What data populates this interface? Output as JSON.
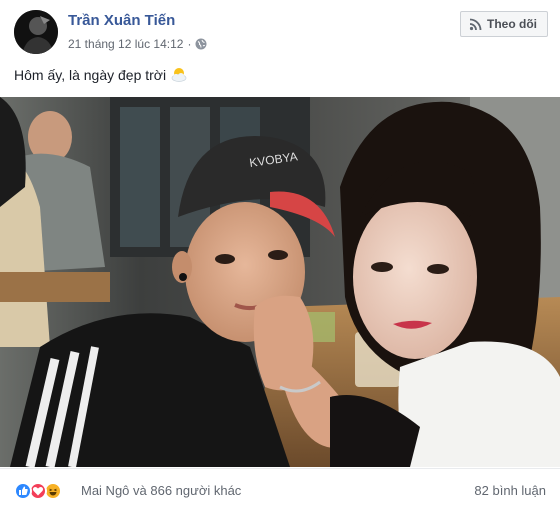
{
  "post": {
    "author": "Trần Xuân Tiến",
    "date": "21 tháng 12 lúc 14:12",
    "separator": "·",
    "follow_label": "Theo dõi",
    "caption": "Hôm ấy, là ngày đẹp trời",
    "caption_emoji": "sun-behind-cloud-icon",
    "photo_cap_text": "KVOBYA"
  },
  "footer": {
    "reactions": [
      "like",
      "love",
      "haha"
    ],
    "reactions_text": "Mai Ngô và 866 người khác",
    "comments_text": "82 bình luận"
  },
  "colors": {
    "author": "#385898",
    "meta": "#616770",
    "like": "#2d88ff",
    "love": "#f33e58",
    "haha": "#f7b125"
  }
}
